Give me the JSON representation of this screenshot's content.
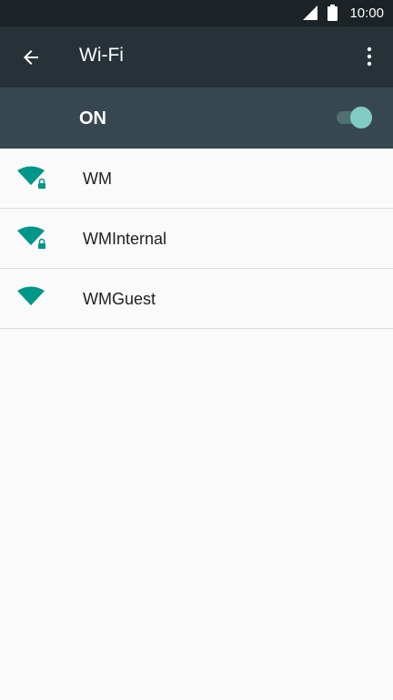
{
  "status_bar": {
    "time": "10:00",
    "icons": [
      "cellular-signal-icon",
      "battery-icon"
    ]
  },
  "app_bar": {
    "title": "Wi-Fi",
    "back_icon": "arrow-left-icon",
    "menu_icon": "more-vert-icon"
  },
  "wifi_toggle": {
    "label": "ON",
    "state": true
  },
  "networks": [
    {
      "ssid": "WM",
      "secured": true
    },
    {
      "ssid": "WMInternal",
      "secured": true
    },
    {
      "ssid": "WMGuest",
      "secured": false
    }
  ],
  "colors": {
    "status_bar": "#1c2327",
    "app_bar": "#263238",
    "toggle_bar": "#37474f",
    "accent": "#009688",
    "switch_thumb": "#80cbc4"
  }
}
